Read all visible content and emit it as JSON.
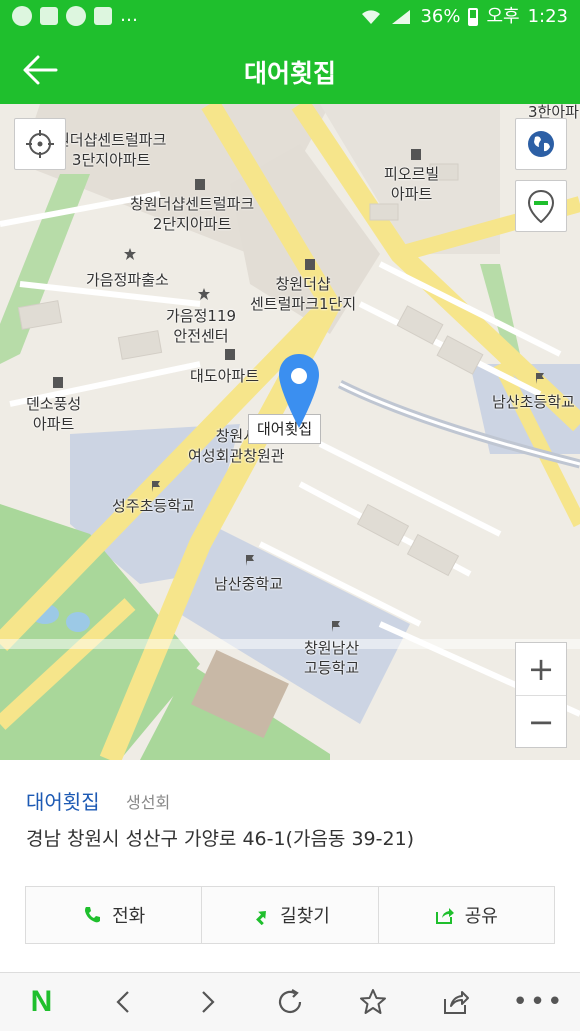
{
  "status_bar": {
    "battery": "36%",
    "ampm": "오후",
    "time": "1:23"
  },
  "header": {
    "title": "대어횟집",
    "back_icon": "arrow-left-icon"
  },
  "map": {
    "callout": "대어횟집",
    "labels": [
      "원더샵센트럴파크\n3단지아파트",
      "창원더샵센트럴파크\n2단지아파트",
      "피오르빌\n아파트",
      "가음정파출소",
      "창원더샵\n센트럴파크1단지",
      "가음정119\n안전센터",
      "대도아파트",
      "덴소풍성\n아파트",
      "남산초등학교",
      "창원시\n여성회관창원관",
      "성주초등학교",
      "남산중학교",
      "창원남산\n고등학교",
      "3한아파"
    ],
    "zoom_in": "+",
    "zoom_out": "−"
  },
  "place": {
    "name": "대어횟집",
    "category": "생선회",
    "address": "경남 창원시 성산구 가양로 46-1(가음동 39-21)"
  },
  "actions": {
    "call": "전화",
    "directions": "길찾기",
    "share": "공유"
  },
  "bottom_nav": {
    "logo": "N",
    "more": "•••"
  },
  "colors": {
    "brand_green": "#1fbf2d",
    "link_blue": "#1d5ab4",
    "pin_blue": "#3b8ff0"
  }
}
